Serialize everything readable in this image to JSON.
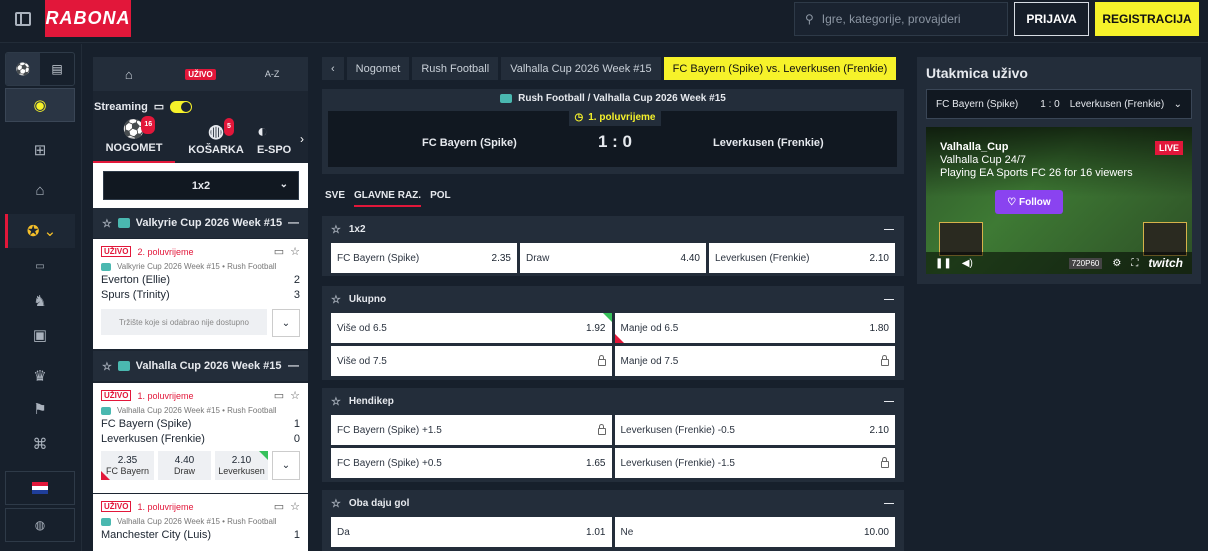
{
  "header": {
    "logo": "RABONA",
    "search_placeholder": "Igre, kategorije, provajderi",
    "login_label": "PRIJAVA",
    "register_label": "REGISTRACIJA"
  },
  "left_nav": {
    "icons": [
      "soccer-ball-icon",
      "betslip-icon",
      "live-ball-icon",
      "gift-icon",
      "home-icon",
      "sports-icon",
      "live-tv-icon",
      "horse-icon",
      "virtual-icon",
      "trophy-icon",
      "racing-flag-icon",
      "esports-icon",
      "flag-icon",
      "support-icon"
    ]
  },
  "sports_panel": {
    "tabs": {
      "home": "⌂",
      "live": "UŽIVO",
      "az": "A-Z"
    },
    "streaming_label": "Streaming",
    "sports": [
      {
        "label": "NOGOMET",
        "count": "16"
      },
      {
        "label": "KOŠARKA",
        "count": "5"
      },
      {
        "label": "E-SPO",
        "count": ""
      }
    ],
    "market_select": "1x2",
    "competitions": [
      {
        "title": "Valkyrie Cup 2026 Week #15 • Rush Football",
        "live": "UŽIVO",
        "period": "2. poluvrijeme",
        "sub": "Valkyrie Cup 2026 Week #15 • Rush Football",
        "team1": "Everton (Ellie)",
        "score1": "2",
        "team2": "Spurs (Trinity)",
        "score2": "3",
        "unavailable": "Tržište koje si odabrao nije dostupno"
      },
      {
        "title": "Valhalla Cup 2026 Week #15 • Rush Football",
        "live": "UŽIVO",
        "period": "1. poluvrijeme",
        "sub": "Valhalla Cup 2026 Week #15 • Rush Football",
        "team1": "FC Bayern (Spike)",
        "score1": "1",
        "team2": "Leverkusen (Frenkie)",
        "score2": "0",
        "odds": [
          {
            "v": "2.35",
            "n": "FC Bayern"
          },
          {
            "v": "4.40",
            "n": "Draw"
          },
          {
            "v": "2.10",
            "n": "Leverkusen"
          }
        ]
      },
      {
        "live": "UŽIVO",
        "period": "1. poluvrijeme",
        "sub": "Valhalla Cup 2026 Week #15 • Rush Football",
        "team1": "Manchester City (Luis)",
        "score1": "1"
      }
    ]
  },
  "breadcrumbs": [
    "Nogomet",
    "Rush Football",
    "Valhalla Cup 2026 Week #15",
    "FC Bayern (Spike) vs. Leverkusen (Frenkie)"
  ],
  "match": {
    "path": "Rush Football / Valhalla Cup 2026 Week #15",
    "period": "1. poluvrijeme",
    "home": "FC Bayern (Spike)",
    "score": "1 : 0",
    "away": "Leverkusen (Frenkie)"
  },
  "filter_tabs": [
    "SVE",
    "GLAVNE RAZ.",
    "POL"
  ],
  "markets": [
    {
      "title": "1x2",
      "rows": [
        [
          {
            "l": "FC Bayern (Spike)",
            "v": "2.35"
          },
          {
            "l": "Draw",
            "v": "4.40"
          },
          {
            "l": "Leverkusen (Frenkie)",
            "v": "2.10"
          }
        ]
      ]
    },
    {
      "title": "Ukupno",
      "rows": [
        [
          {
            "l": "Više od 6.5",
            "v": "1.92"
          },
          {
            "l": "Manje od 6.5",
            "v": "1.80"
          }
        ],
        [
          {
            "l": "Više od 7.5",
            "v": ""
          },
          {
            "l": "Manje od 7.5",
            "v": ""
          }
        ]
      ]
    },
    {
      "title": "Hendikep",
      "rows": [
        [
          {
            "l": "FC Bayern (Spike) +1.5",
            "v": ""
          },
          {
            "l": "Leverkusen (Frenkie) -0.5",
            "v": "2.10"
          }
        ],
        [
          {
            "l": "FC Bayern (Spike) +0.5",
            "v": "1.65"
          },
          {
            "l": "Leverkusen (Frenkie) -1.5",
            "v": ""
          }
        ]
      ]
    },
    {
      "title": "Oba daju gol",
      "rows": [
        [
          {
            "l": "Da",
            "v": "1.01"
          },
          {
            "l": "Ne",
            "v": "10.00"
          }
        ]
      ]
    }
  ],
  "live_panel": {
    "title": "Utakmica uživo",
    "home": "FC Bayern (Spike)",
    "score": "1 : 0",
    "away": "Leverkusen (Frenkie)",
    "stream_channel": "Valhalla_Cup",
    "stream_line1": "Valhalla Cup 24/7",
    "stream_line2": "Playing EA Sports FC 26 for 16 viewers",
    "live_badge": "LIVE",
    "follow": "Follow",
    "quality": "720P60",
    "brand": "twitch"
  }
}
